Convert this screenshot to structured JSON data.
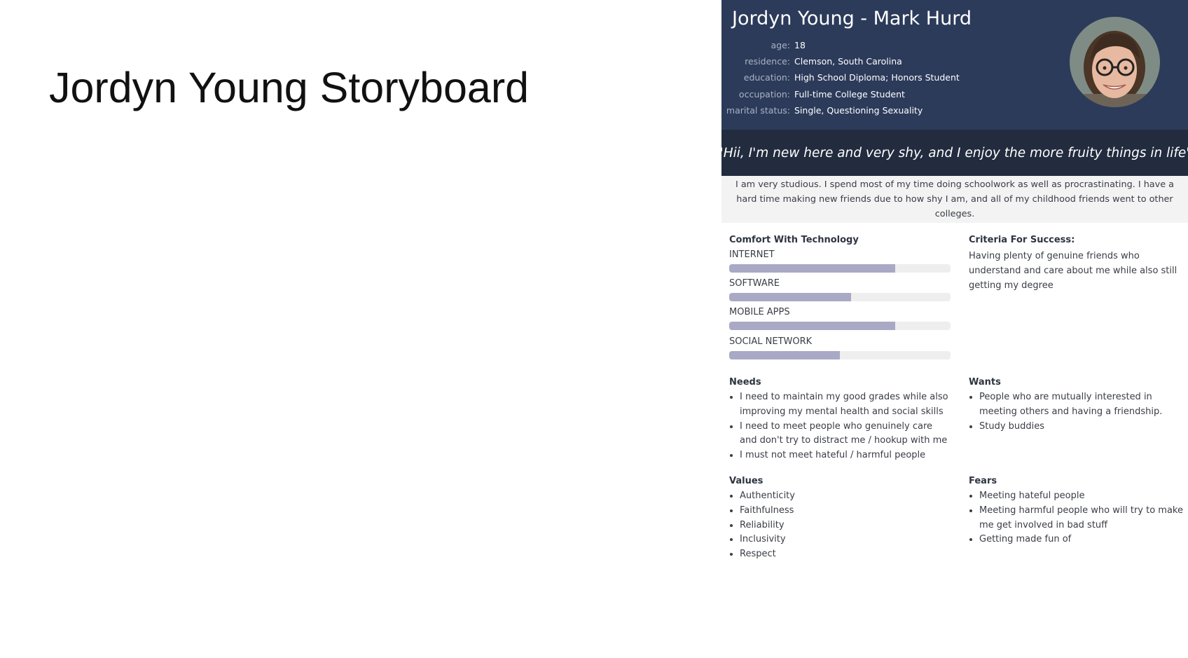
{
  "slide": {
    "title": "Jordyn Young Storyboard"
  },
  "persona": {
    "name": "Jordyn Young - Mark Hurd",
    "info": [
      {
        "label": "age:",
        "value": "18"
      },
      {
        "label": "residence:",
        "value": "Clemson, South Carolina"
      },
      {
        "label": "education:",
        "value": "High School Diploma; Honors Student"
      },
      {
        "label": "occupation:",
        "value": "Full-time College Student"
      },
      {
        "label": "marital status:",
        "value": "Single, Questioning Sexuality"
      }
    ],
    "quote": "\"Hii, I'm new here and very shy, and I enjoy the more fruity things in life\"",
    "bio": "I am very studious. I spend most of my time doing schoolwork as well as procrastinating. I have a hard time making new friends due to how shy I am, and all of my childhood friends went to other colleges.",
    "tech": {
      "title": "Comfort With Technology",
      "items": [
        {
          "label": "INTERNET",
          "level": 0.75
        },
        {
          "label": "SOFTWARE",
          "level": 0.55
        },
        {
          "label": "MOBILE APPS",
          "level": 0.75
        },
        {
          "label": "SOCIAL NETWORK",
          "level": 0.5
        }
      ]
    },
    "criteria": {
      "title": "Criteria For Success:",
      "text": "Having plenty of genuine friends who understand and care about me while also still getting my degree"
    },
    "needs": {
      "title": "Needs",
      "items": [
        "I need to maintain my good grades while also improving my mental health and social skills",
        "I need to meet people who genuinely care and don't try to distract me / hookup with me",
        "I must not meet hateful / harmful people"
      ]
    },
    "wants": {
      "title": "Wants",
      "items": [
        "People who are mutually interested in meeting others and having a friendship.",
        "Study buddies"
      ]
    },
    "values": {
      "title": "Values",
      "items": [
        "Authenticity",
        "Faithfulness",
        "Reliability",
        "Inclusivity",
        "Respect"
      ]
    },
    "fears": {
      "title": "Fears",
      "items": [
        "Meeting hateful people",
        "Meeting harmful people who will try to make me get involved in bad stuff",
        "Getting made fun of"
      ]
    }
  },
  "colors": {
    "header_bg": "#2c3b5a",
    "quote_bg": "#222c3e",
    "bar_fill": "#a9a9c6",
    "bar_track": "#eeeeee"
  }
}
